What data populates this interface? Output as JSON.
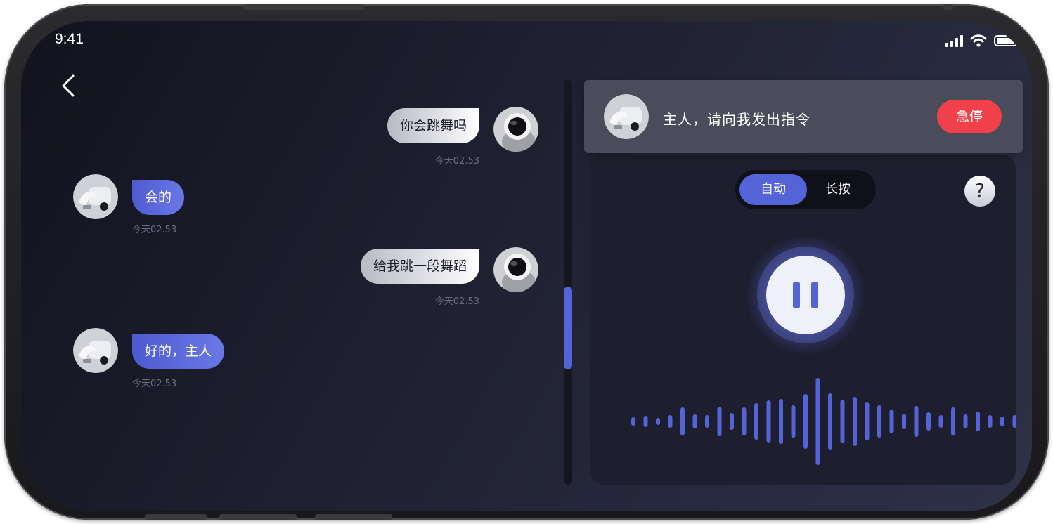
{
  "status_bar": {
    "time": "9:41"
  },
  "chat": {
    "messages": [
      {
        "role": "user",
        "text": "你会跳舞吗",
        "time": "今天02.53"
      },
      {
        "role": "bot",
        "text": "会的",
        "time": "今天02.53"
      },
      {
        "role": "user",
        "text": "给我跳一段舞蹈",
        "time": "今天02.53"
      },
      {
        "role": "bot",
        "text": "好的，主人",
        "time": "今天02.53"
      }
    ]
  },
  "control_panel": {
    "prompt": "主人，请向我发出指令",
    "emergency_stop_label": "急停",
    "mode_toggle": {
      "options": [
        "自动",
        "长按"
      ],
      "selected": "自动"
    },
    "help_label": "?",
    "voice_state": "paused"
  },
  "colors": {
    "accent": "#5563d8",
    "stop": "#f0414a",
    "background": "#1f2131",
    "panel": "#1d1f2e",
    "header_card": "#4a4b5b"
  },
  "icons": {
    "back": "chevron-left-icon",
    "signal": "cellular-signal-icon",
    "wifi": "wifi-icon",
    "battery": "battery-icon",
    "pause": "pause-icon",
    "waveform": "audio-waveform-icon"
  }
}
